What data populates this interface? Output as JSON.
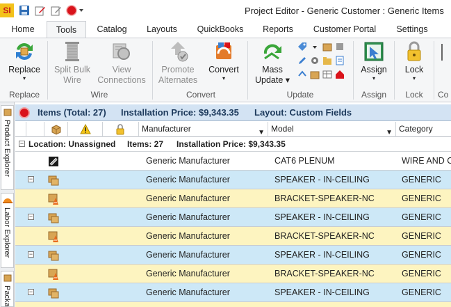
{
  "window": {
    "app_logo": "SI",
    "title": "Project Editor - Generic Customer : Generic Items"
  },
  "tabs": [
    {
      "label": "Home"
    },
    {
      "label": "Tools"
    },
    {
      "label": "Catalog"
    },
    {
      "label": "Layouts"
    },
    {
      "label": "QuickBooks"
    },
    {
      "label": "Reports"
    },
    {
      "label": "Customer Portal"
    },
    {
      "label": "Settings"
    }
  ],
  "ribbon": {
    "replace": {
      "line1": "Replace",
      "line2": "▾"
    },
    "split_bulk_wire": {
      "line1": "Split Bulk",
      "line2": "Wire"
    },
    "view_connections": {
      "line1": "View",
      "line2": "Connections"
    },
    "promote_alternates": {
      "line1": "Promote",
      "line2": "Alternates"
    },
    "convert": {
      "line1": "Convert",
      "line2": "▾"
    },
    "mass_update": {
      "line1": "Mass",
      "line2": "Update ▾"
    },
    "assign": {
      "line1": "Assign",
      "line2": "▾"
    },
    "lock": {
      "line1": "Lock",
      "line2": "▾"
    },
    "groups": {
      "replace": "Replace",
      "wire": "Wire",
      "convert": "Convert",
      "update": "Update",
      "assign": "Assign",
      "lock": "Lock",
      "co": "Co"
    }
  },
  "sidebar": {
    "tabs": [
      {
        "label": "Product Explorer"
      },
      {
        "label": "Labor Explorer"
      },
      {
        "label": "Packages"
      }
    ]
  },
  "grid": {
    "items_label": "Items (Total: 27)",
    "installation_label": "Installation Price: $9,343.35",
    "layout_label": "Layout: Custom Fields",
    "columns": {
      "manufacturer": "Manufacturer",
      "model": "Model",
      "category": "Category"
    },
    "location_row": {
      "location": "Location: Unassigned",
      "items": "Items: 27",
      "installation": "Installation Price: $9,343.35"
    },
    "rows": [
      {
        "manufacturer": "Generic Manufacturer",
        "model": "CAT6 PLENUM",
        "category": "WIRE AND CA",
        "style": "white",
        "icon": "wire-icon"
      },
      {
        "manufacturer": "Generic Manufacturer",
        "model": "SPEAKER - IN-CEILING",
        "category": "GENERIC",
        "style": "blue",
        "icon": "package-icon"
      },
      {
        "manufacturer": "Generic Manufacturer",
        "model": "BRACKET-SPEAKER-NC",
        "category": "GENERIC",
        "style": "yellow",
        "icon": "accessory-icon"
      },
      {
        "manufacturer": "Generic Manufacturer",
        "model": "SPEAKER - IN-CEILING",
        "category": "GENERIC",
        "style": "blue",
        "icon": "package-icon"
      },
      {
        "manufacturer": "Generic Manufacturer",
        "model": "BRACKET-SPEAKER-NC",
        "category": "GENERIC",
        "style": "yellow",
        "icon": "accessory-icon"
      },
      {
        "manufacturer": "Generic Manufacturer",
        "model": "SPEAKER - IN-CEILING",
        "category": "GENERIC",
        "style": "blue",
        "icon": "package-icon"
      },
      {
        "manufacturer": "Generic Manufacturer",
        "model": "BRACKET-SPEAKER-NC",
        "category": "GENERIC",
        "style": "yellow",
        "icon": "accessory-icon"
      },
      {
        "manufacturer": "Generic Manufacturer",
        "model": "SPEAKER - IN-CEILING",
        "category": "GENERIC",
        "style": "blue",
        "icon": "package-icon"
      }
    ]
  },
  "colors": {
    "row_blue": "#cde8f7",
    "row_yellow": "#fdf4c0",
    "header_bar": "#d3e3f3",
    "accent_red": "#d9131b"
  }
}
